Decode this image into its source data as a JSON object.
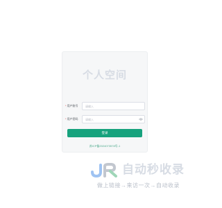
{
  "login": {
    "title": "个人空间",
    "username_label": "用户账号",
    "username_placeholder": "请输入",
    "password_label": "用户密码",
    "password_placeholder": "请输入",
    "login_button": "登录",
    "icp_text": "苏ICP备2024073578号-1"
  },
  "watermark": {
    "logo_text": "JR",
    "title": "自动秒收录",
    "slogan": "做上链接→来访一次→自动收录"
  },
  "colors": {
    "accent": "#17a27d",
    "required_mark": "#e04646",
    "card_background": "#f6f7f8",
    "watermark": "#d7dce4"
  },
  "icons": {
    "password_toggle": "eye-icon"
  }
}
